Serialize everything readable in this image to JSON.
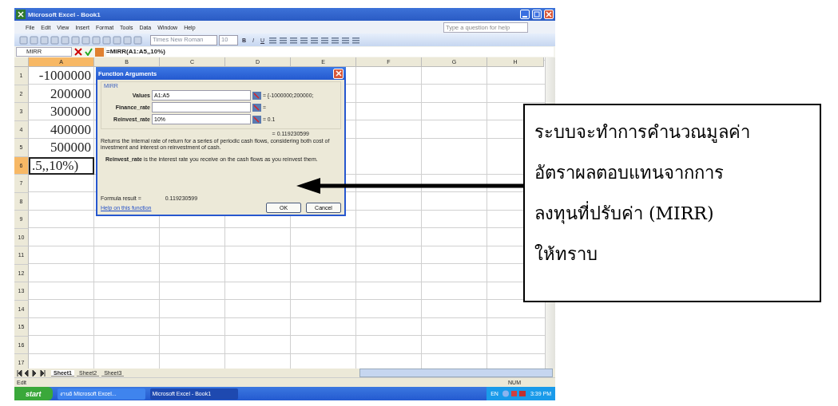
{
  "window": {
    "title": "Microsoft Excel - Book1"
  },
  "menu": [
    "File",
    "Edit",
    "View",
    "Insert",
    "Format",
    "Tools",
    "Data",
    "Window",
    "Help"
  ],
  "help_search": {
    "placeholder": "Type a question for help"
  },
  "toolbar": {
    "font": "Times New Roman",
    "size": "10",
    "bold": "B",
    "italic": "I",
    "underline": "U"
  },
  "formula_bar": {
    "name_box": "MIRR",
    "formula": "=MIRR(A1:A5,,10%)"
  },
  "sheet": {
    "columns": [
      {
        "label": "A",
        "selected": true
      },
      {
        "label": "B",
        "selected": false
      },
      {
        "label": "C",
        "selected": false
      },
      {
        "label": "D",
        "selected": false
      },
      {
        "label": "E",
        "selected": false
      },
      {
        "label": "F",
        "selected": false
      },
      {
        "label": "G",
        "selected": false
      },
      {
        "label": "H",
        "selected": false
      }
    ],
    "rows": [
      {
        "number": "1",
        "selected": false,
        "value": "-1000000"
      },
      {
        "number": "2",
        "selected": false,
        "value": "200000"
      },
      {
        "number": "3",
        "selected": false,
        "value": "300000"
      },
      {
        "number": "4",
        "selected": false,
        "value": "400000"
      },
      {
        "number": "5",
        "selected": false,
        "value": "500000"
      },
      {
        "number": "6",
        "selected": true,
        "value": ".5,,10%)"
      },
      {
        "number": "7",
        "selected": false
      },
      {
        "number": "8",
        "selected": false
      },
      {
        "number": "9",
        "selected": false
      },
      {
        "number": "10",
        "selected": false
      },
      {
        "number": "11",
        "selected": false
      },
      {
        "number": "12",
        "selected": false
      },
      {
        "number": "13",
        "selected": false
      },
      {
        "number": "14",
        "selected": false
      },
      {
        "number": "15",
        "selected": false
      },
      {
        "number": "16",
        "selected": false
      },
      {
        "number": "17",
        "selected": false
      }
    ]
  },
  "dialog": {
    "title": "Function Arguments",
    "function": "MIRR",
    "args": [
      {
        "label": "Values",
        "value": "A1:A5",
        "result": "= {-1000000;200000;"
      },
      {
        "label": "Finance_rate",
        "result": "="
      },
      {
        "label": "Reinvest_rate",
        "value": "10%",
        "result": "= 0.1"
      }
    ],
    "result": "= 0.119230599",
    "description": "Returns the internal rate of return for a series of periodic cash flows, considering both cost of investment and interest on reinvestment of cash.",
    "arg_help": "**Reinvest_rate** is the interest rate you receive on the cash flows as you reinvest them.",
    "formula_result_label": "Formula result =",
    "formula_result": "0.119230599",
    "help_link": "Help on this function",
    "buttons": [
      "OK",
      "Cancel"
    ]
  },
  "sheet_tabs": [
    {
      "label": "Sheet1",
      "selected": true
    },
    {
      "label": "Sheet2",
      "selected": false
    },
    {
      "label": "Sheet3",
      "selected": false
    }
  ],
  "status_bar": {
    "mode": "Edit",
    "num": "NUM"
  },
  "taskbar": {
    "start": "start",
    "tasks": [
      {
        "label": "งาน6 Microsoft Excel...",
        "selected": false
      },
      {
        "label": "Microsoft Excel - Book1",
        "selected": true
      }
    ],
    "language": "EN",
    "time": "3:39 PM"
  },
  "callout": {
    "lines": [
      "ระบบจะทำการคำนวณมูลค่า",
      "อัตราผลตอบแทนจากการ",
      "ลงทุนที่ปรับค่า (MIRR)",
      "ให้ทราบ"
    ]
  }
}
